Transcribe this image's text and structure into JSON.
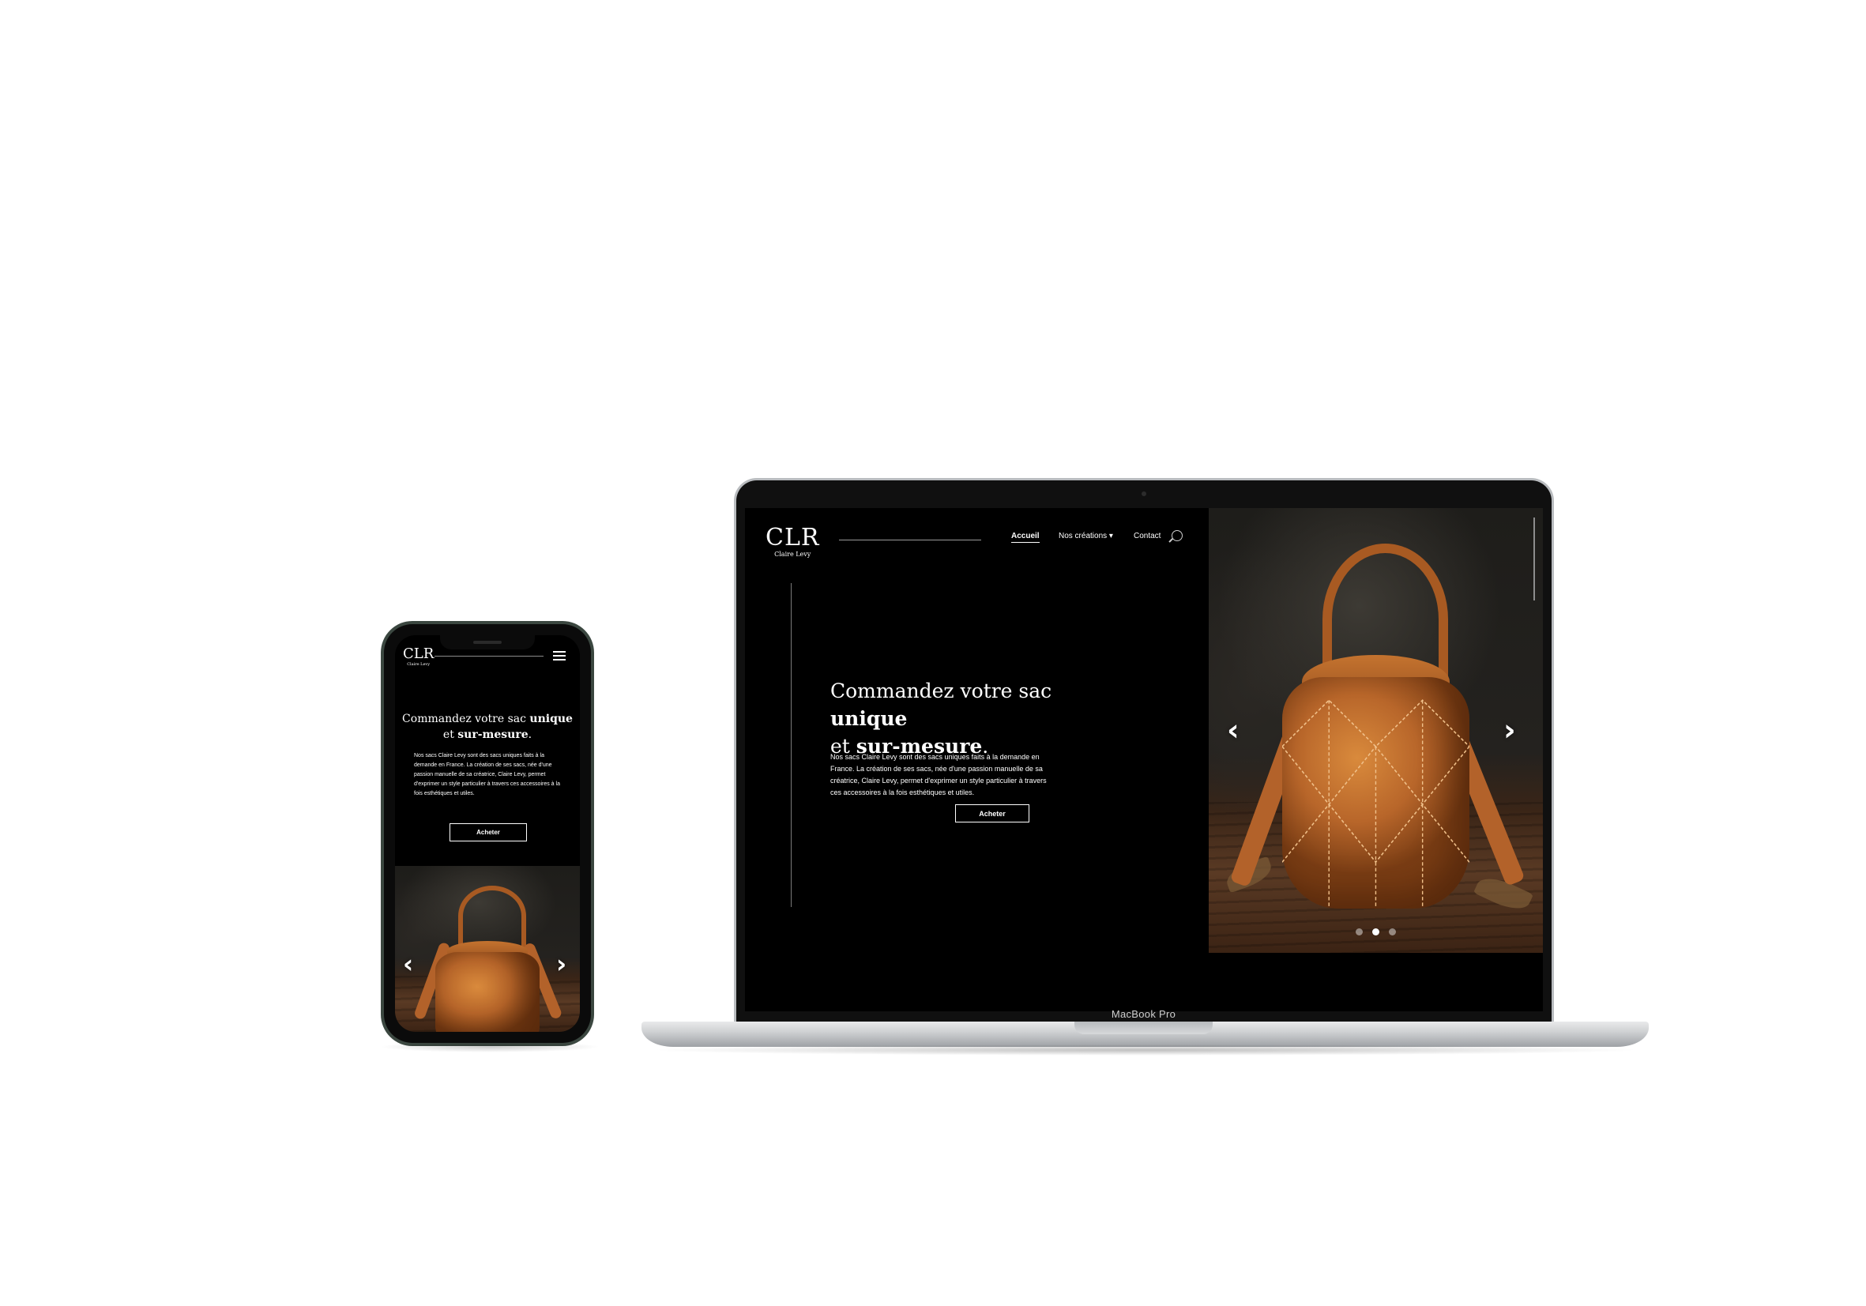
{
  "brand": {
    "mark": "CLR",
    "name": "Claire Levy"
  },
  "nav": {
    "items": [
      {
        "label": "Accueil",
        "active": true
      },
      {
        "label": "Nos créations ▾",
        "active": false
      },
      {
        "label": "Contact",
        "active": false
      }
    ],
    "search_icon": "search-icon",
    "menu_icon": "hamburger-icon"
  },
  "hero": {
    "title_part1": "Commandez votre sac ",
    "title_bold1": "unique",
    "title_part2": "et ",
    "title_bold2": "sur-mesure",
    "title_end": ".",
    "body": "Nos sacs Claire Levy sont des sacs uniques faits à la demande en France. La création de ses sacs, née d'une passion manuelle de sa créatrice, Claire Levy, permet d'exprimer un style particulier à travers ces accessoires à la fois esthétiques et utiles.",
    "cta": "Acheter"
  },
  "carousel": {
    "prev_label": "‹",
    "next_label": "›",
    "slide_count": 3,
    "active_slide": 1
  },
  "device": {
    "laptop_label": "MacBook Pro"
  },
  "colors": {
    "background": "#000000",
    "text": "#ffffff",
    "leather": "#b8662a",
    "page": "#ffffff"
  }
}
